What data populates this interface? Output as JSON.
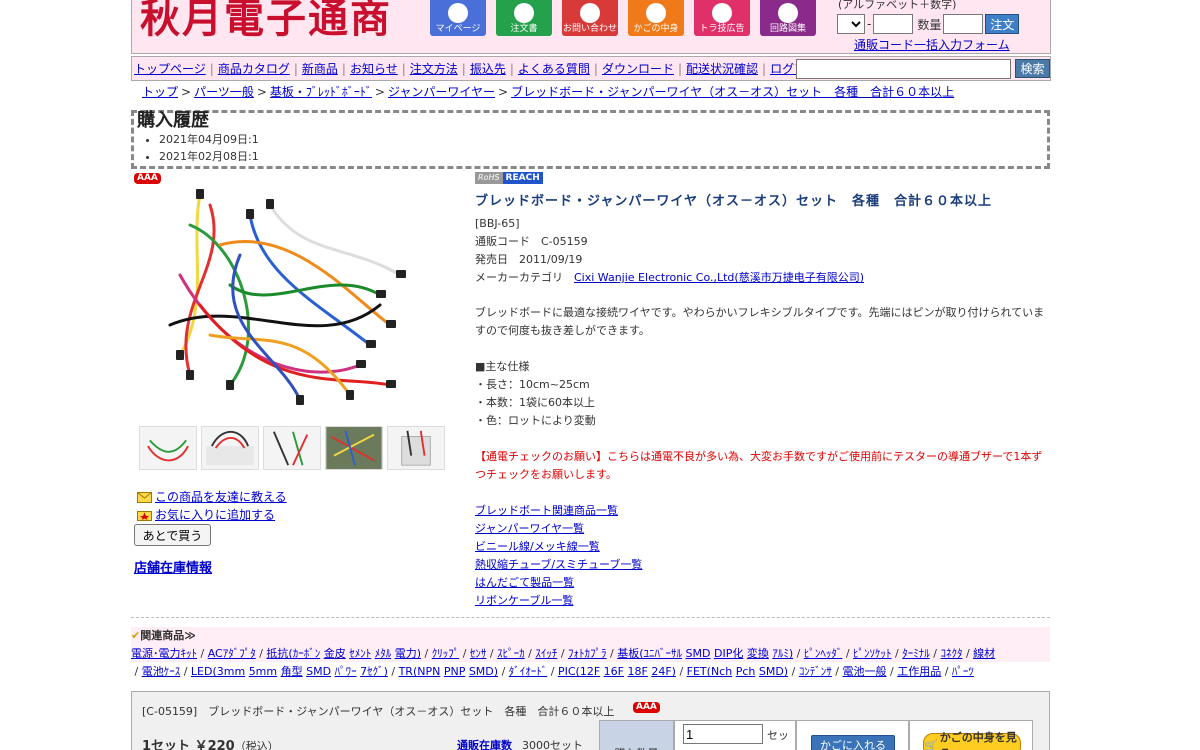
{
  "header": {
    "logo": "秋月電子通商",
    "buttons": [
      {
        "label": "マイページ",
        "icon": "person-icon"
      },
      {
        "label": "注文書",
        "icon": "order-form-icon"
      },
      {
        "label": "お問い合わせ",
        "icon": "mail-icon"
      },
      {
        "label": "かごの中身",
        "icon": "cart-icon"
      },
      {
        "label": "トラ技広告",
        "icon": "magazine-icon"
      },
      {
        "label": "回路図集",
        "icon": "circuit-icon"
      }
    ],
    "code_note": "(アルファベット＋数字)",
    "qty_label": "数量",
    "order_button": "注文",
    "bulk_form_link": "通販コード一括入力フォーム",
    "code_dash": "-"
  },
  "nav": {
    "items": [
      "トップページ",
      "商品カタログ",
      "新商品",
      "お知らせ",
      "注文方法",
      "振込先",
      "よくある質問",
      "ダウンロード",
      "配送状況確認",
      "ログアウト"
    ],
    "separator": "|",
    "search_button": "検索"
  },
  "breadcrumb": {
    "items": [
      "トップ",
      "パーツ一般",
      "基板・ﾌﾞﾚｯﾄﾞﾎﾞｰﾄﾞ",
      "ジャンパーワイヤー",
      "ブレッドボード・ジャンパーワイヤ（オス－オス）セット　各種　合計６０本以上"
    ],
    "arrow": ">"
  },
  "history": {
    "title": "購入履歴",
    "entries": [
      "2021年04月09日:1",
      "2021年02月08日:1"
    ]
  },
  "badges": {
    "aaa": "AAA",
    "rohs": "RoHS",
    "reach": "REACH"
  },
  "product": {
    "title": "ブレッドボード・ジャンパーワイヤ（オス－オス）セット　各種　合計６０本以上",
    "model": "[BBJ-65]",
    "code_line": "通販コード　C-05159",
    "release_line": "発売日　2011/09/19",
    "maker_label": "メーカーカテゴリ　",
    "maker_link": "Cixi Wanjie Electronic Co.,Ltd(慈溪市万捷电子有限公司)",
    "desc": "ブレッドボードに最適な接続ワイヤです。やわらかいフレキシブルタイプです。先端にはピンが取り付けられていますので何度も抜き差しができます。",
    "spec_head": "■主な仕様",
    "specs": [
      "・長さ：10cm~25cm",
      "・本数：1袋に60本以上",
      "・色：ロットにより変動"
    ],
    "notice": "【通電チェックのお願い】こちらは通電不良が多い為、大変お手数ですがご使用前にテスターの導通ブザーで1本ずつチェックをお願いします。",
    "links": [
      "ブレッドボート関連商品一覧",
      "ジャンパーワイヤ一覧",
      "ビニール線/メッキ線一覧",
      "熱収縮チューブ/スミチューブ一覧",
      "はんだごて製品一覧",
      "リボンケーブル一覧"
    ]
  },
  "left": {
    "tell_friend": "この商品を友達に教える",
    "add_favorite": "お気に入りに追加する",
    "buy_later": "あとで買う",
    "store_stock": "店舗在庫情報"
  },
  "related": {
    "label": "関連商品≫",
    "line1": [
      {
        "t": "電源･電力ｷｯﾄ",
        "link": true
      },
      {
        "t": " / ",
        "link": false
      },
      {
        "t": "ACｱﾀﾞﾌﾟﾀ",
        "link": true
      },
      {
        "t": " / ",
        "link": false
      },
      {
        "t": "抵抗(ｶｰﾎﾞﾝ",
        "link": true
      },
      {
        "t": " ",
        "link": false
      },
      {
        "t": "金皮",
        "link": true
      },
      {
        "t": " ",
        "link": false
      },
      {
        "t": "ｾﾒﾝﾄ",
        "link": true
      },
      {
        "t": " ",
        "link": false
      },
      {
        "t": "ﾒﾀﾙ",
        "link": true
      },
      {
        "t": " ",
        "link": false
      },
      {
        "t": "電力)",
        "link": true
      },
      {
        "t": " / ",
        "link": false
      },
      {
        "t": "ｸﾘｯﾌﾟ",
        "link": true
      },
      {
        "t": " / ",
        "link": false
      },
      {
        "t": "ｾﾝｻ",
        "link": true
      },
      {
        "t": " / ",
        "link": false
      },
      {
        "t": "ｽﾋﾟｰｶ",
        "link": true
      },
      {
        "t": " / ",
        "link": false
      },
      {
        "t": "ｽｲｯﾁ",
        "link": true
      },
      {
        "t": " / ",
        "link": false
      },
      {
        "t": "ﾌｫﾄｶﾌﾟﾗ",
        "link": true
      },
      {
        "t": " / ",
        "link": false
      },
      {
        "t": "基板(ﾕﾆﾊﾞｰｻﾙ",
        "link": true
      },
      {
        "t": " ",
        "link": false
      },
      {
        "t": "SMD",
        "link": true
      },
      {
        "t": " ",
        "link": false
      },
      {
        "t": "DIP化",
        "link": true
      },
      {
        "t": " ",
        "link": false
      },
      {
        "t": "変換",
        "link": true
      },
      {
        "t": " ",
        "link": false
      },
      {
        "t": "ｱﾙﾐ)",
        "link": true
      },
      {
        "t": " / ",
        "link": false
      },
      {
        "t": "ﾋﾟﾝﾍｯﾀﾞ",
        "link": true
      },
      {
        "t": " / ",
        "link": false
      },
      {
        "t": "ﾋﾟﾝｿｹｯﾄ",
        "link": true
      },
      {
        "t": " / ",
        "link": false
      },
      {
        "t": "ﾀｰﾐﾅﾙ",
        "link": true
      },
      {
        "t": " / ",
        "link": false
      },
      {
        "t": "ｺﾈｸﾀ",
        "link": true
      },
      {
        "t": " / ",
        "link": false
      },
      {
        "t": "線材",
        "link": true
      }
    ],
    "line2": [
      {
        "t": " / ",
        "link": false
      },
      {
        "t": "電池ｹｰｽ",
        "link": true
      },
      {
        "t": " / ",
        "link": false
      },
      {
        "t": "LED(3mm",
        "link": true
      },
      {
        "t": " ",
        "link": false
      },
      {
        "t": "5mm",
        "link": true
      },
      {
        "t": " ",
        "link": false
      },
      {
        "t": "角型",
        "link": true
      },
      {
        "t": " ",
        "link": false
      },
      {
        "t": "SMD",
        "link": true
      },
      {
        "t": " ",
        "link": false
      },
      {
        "t": "ﾊﾟﾜｰ",
        "link": true
      },
      {
        "t": " ",
        "link": false
      },
      {
        "t": "7ｾｸﾞ)",
        "link": true
      },
      {
        "t": " / ",
        "link": false
      },
      {
        "t": "TR(NPN",
        "link": true
      },
      {
        "t": " ",
        "link": false
      },
      {
        "t": "PNP",
        "link": true
      },
      {
        "t": " ",
        "link": false
      },
      {
        "t": "SMD)",
        "link": true
      },
      {
        "t": " / ",
        "link": false
      },
      {
        "t": "ﾀﾞｲｵｰﾄﾞ",
        "link": true
      },
      {
        "t": " / ",
        "link": false
      },
      {
        "t": "PIC(12F",
        "link": true
      },
      {
        "t": " ",
        "link": false
      },
      {
        "t": "16F",
        "link": true
      },
      {
        "t": " ",
        "link": false
      },
      {
        "t": "18F",
        "link": true
      },
      {
        "t": " ",
        "link": false
      },
      {
        "t": "24F)",
        "link": true
      },
      {
        "t": " / ",
        "link": false
      },
      {
        "t": "FET(Nch",
        "link": true
      },
      {
        "t": " ",
        "link": false
      },
      {
        "t": "Pch",
        "link": true
      },
      {
        "t": " ",
        "link": false
      },
      {
        "t": "SMD)",
        "link": true
      },
      {
        "t": " / ",
        "link": false
      },
      {
        "t": "ｺﾝﾃﾞﾝｻ",
        "link": true
      },
      {
        "t": " / ",
        "link": false
      },
      {
        "t": "電池一般",
        "link": true
      },
      {
        "t": " / ",
        "link": false
      },
      {
        "t": "工作用品",
        "link": true
      },
      {
        "t": " / ",
        "link": false
      },
      {
        "t": "ﾊﾟｰﾂ",
        "link": true
      }
    ]
  },
  "cart": {
    "title": "[C-05159]　ブレッドボード・ジャンパーワイヤ（オス－オス）セット　各種　合計６０本以上",
    "price": "1セット ￥220",
    "tax": "（税込）",
    "stock_link": "通販在庫数",
    "stock_qty": "3000セット",
    "qty_label": "購入数量",
    "qty_value": "1",
    "unit": "セッ",
    "add_button": "かごに入れる",
    "view_button": "かごの中身を見る"
  },
  "colors": {
    "brand_red": "#c8102e",
    "header_pink": "#ffe6f0",
    "link_blue": "#0000cc",
    "title_navy": "#1a3d7c"
  }
}
